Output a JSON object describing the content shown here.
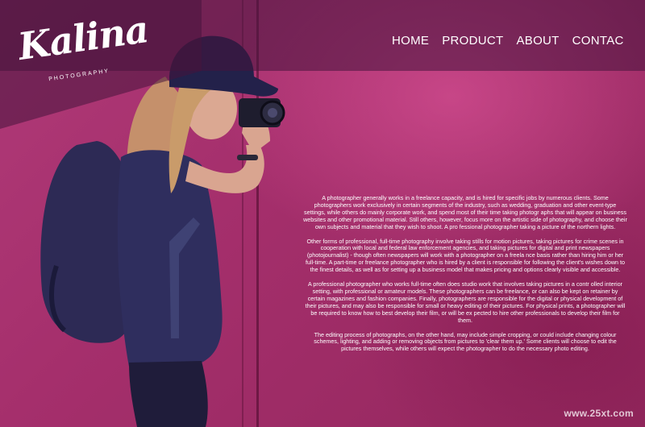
{
  "brand": {
    "name": "Kalina",
    "tagline": "PHOTOGRAPHY"
  },
  "nav": {
    "items": [
      {
        "label": "HOME"
      },
      {
        "label": "PRODUCT"
      },
      {
        "label": "ABOUT"
      },
      {
        "label": "CONTAC"
      }
    ]
  },
  "content": {
    "paragraphs": [
      "A photographer generally works in a freelance capacity, and is hired for specific jobs by numerous clients. Some photographers work exclusively in certain segments of the industry, such as wedding, graduation and other event-type settings, while others do mainly corporate work, and spend most of their time taking photogr aphs that will appear on business websites and other promotional material. Still others, however, focus more on the artistic side of photography, and choose their own subjects and material that they wish to shoot. A pro fessional photographer taking a picture of the northern lights.",
      "Other forms of professional, full-time photography involve taking stills for motion pictures, taking pictures for crime scenes in cooperation with local and federal law enforcement agencies, and taking pictures for digital and print newspapers (photojournalist) - though often newspapers will work with a photographer on a freela nce basis rather than hiring him or her full-time. A part-time or freelance photographer who is hired by a client is responsible for following the client's wishes down to the finest details, as well as for setting up a business model that makes pricing and options clearly visible and accessible.",
      "A professional photographer who works full-time often does studio work that involves taking pictures in a contr olled interior setting, with professional or amateur models. These photographers can be freelance, or can also be kept on retainer by certain magazines and fashion companies. Finally, photographers are responsible for the digital or physical development of their pictures, and may also be responsible for small or heavy editing of their pictures. For physical prints, a photographer will be required to know how to best develop their film, or will be ex pected to hire other professionals to develop their film for them.",
      "The editing process of photographs, on the other hand, may include simple cropping, or could include changing colour schemes, lighting, and adding or removing objects from pictures to 'clear them up.' Some clients will choose to edit the pictures themselves, while others will expect the photographer to do the necessary photo editing."
    ]
  },
  "watermark": "www.25xt.com",
  "colors": {
    "background": "#a6316e",
    "overlay": "#46143c",
    "text": "#ffffff"
  },
  "icons": {
    "hero": "photographer-with-camera-image"
  }
}
